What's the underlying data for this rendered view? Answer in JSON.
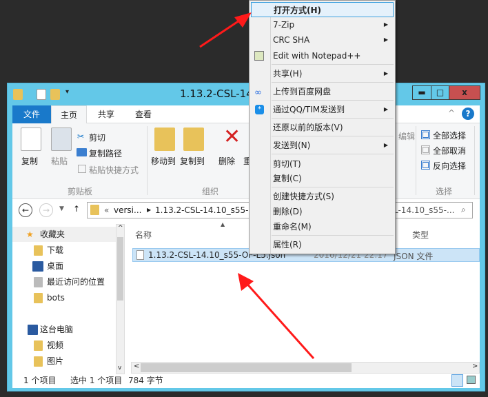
{
  "window": {
    "title": "1.13.2-CSL-14.10_s55-OF-L5",
    "minimize": "▬",
    "maximize": "□",
    "close": "x"
  },
  "ribbon": {
    "tabs": [
      {
        "label": "文件"
      },
      {
        "label": "主页"
      },
      {
        "label": "共享"
      },
      {
        "label": "查看"
      }
    ],
    "clipboard": {
      "copy": "复制",
      "paste": "粘贴",
      "cut": "剪切",
      "copy_path": "复制路径",
      "paste_shortcut": "粘贴快捷方式",
      "group": "剪贴板"
    },
    "organize": {
      "move_to": "移动到",
      "copy_to": "复制到",
      "delete": "删除",
      "rename": "重",
      "group": "组织"
    },
    "edit_partial": "编辑",
    "select": {
      "select_all": "全部选择",
      "select_none": "全部取消",
      "invert": "反向选择",
      "group": "选择"
    }
  },
  "address": {
    "prefix": "«",
    "crumb1": "versi...",
    "crumb2": "1.13.2-CSL-14.10_s55-O",
    "search_tail": "L-14.10_s55-..."
  },
  "nav": {
    "items": [
      {
        "label": "收藏夹"
      },
      {
        "label": "下载"
      },
      {
        "label": "桌面"
      },
      {
        "label": "最近访问的位置"
      },
      {
        "label": "bots"
      },
      {
        "label": "这台电脑"
      },
      {
        "label": "视频"
      },
      {
        "label": "图片"
      }
    ]
  },
  "list": {
    "columns": {
      "name": "名称",
      "type": "类型"
    },
    "rows": [
      {
        "name": "1.13.2-CSL-14.10_s55-OF-L5.json",
        "date": "2016/12/21 22:17",
        "type": "JSON 文件"
      }
    ]
  },
  "status": {
    "count": "1 个项目",
    "selected": "选中 1 个项目",
    "size": "784 字节"
  },
  "menu": {
    "items": [
      {
        "label": "打开方式(H)"
      },
      {
        "label": "7-Zip"
      },
      {
        "label": "CRC SHA"
      },
      {
        "label": "Edit with Notepad++"
      },
      {
        "label": "共享(H)"
      },
      {
        "label": "上传到百度网盘"
      },
      {
        "label": "通过QQ/TIM发送到"
      },
      {
        "label": "还原以前的版本(V)"
      },
      {
        "label": "发送到(N)"
      },
      {
        "label": "剪切(T)"
      },
      {
        "label": "复制(C)"
      },
      {
        "label": "创建快捷方式(S)"
      },
      {
        "label": "删除(D)"
      },
      {
        "label": "重命名(M)"
      },
      {
        "label": "属性(R)"
      }
    ]
  },
  "colors": {
    "accent": "#1979ca",
    "frame": "#63c8e8",
    "close": "#c75050",
    "arrow": "#ff1a1a",
    "selection": "#cce4f7"
  }
}
